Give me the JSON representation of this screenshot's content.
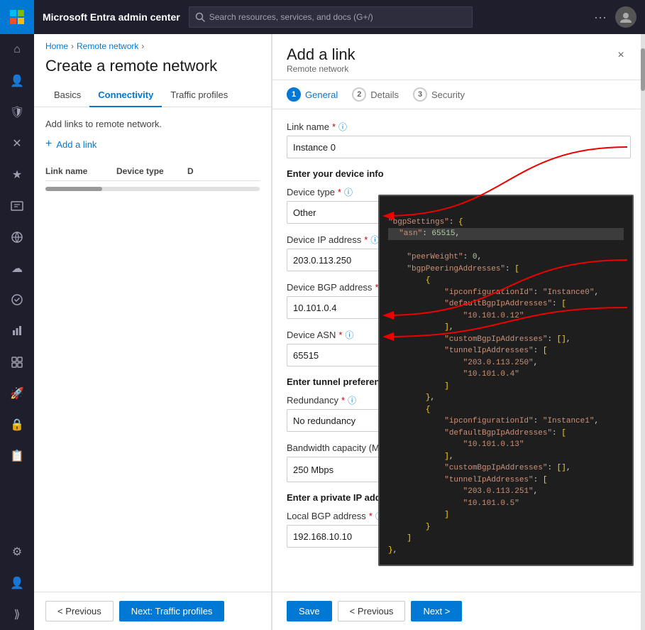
{
  "app": {
    "title": "Microsoft Entra admin center",
    "search_placeholder": "Search resources, services, and docs (G+/)"
  },
  "sidebar": {
    "icons": [
      {
        "name": "home-icon",
        "symbol": "⌂"
      },
      {
        "name": "users-icon",
        "symbol": "👤"
      },
      {
        "name": "shield-icon",
        "symbol": "🛡"
      },
      {
        "name": "cross-icon",
        "symbol": "✕"
      },
      {
        "name": "star-icon",
        "symbol": "★"
      },
      {
        "name": "id-icon",
        "symbol": "🪪"
      },
      {
        "name": "grid-icon",
        "symbol": "⊞"
      },
      {
        "name": "cloud-icon",
        "symbol": "☁"
      },
      {
        "name": "globe-icon",
        "symbol": "🌐"
      },
      {
        "name": "chart-icon",
        "symbol": "▦"
      },
      {
        "name": "puzzle-icon",
        "symbol": "🧩"
      },
      {
        "name": "rocket-icon",
        "symbol": "🚀"
      },
      {
        "name": "lock-icon",
        "symbol": "🔒"
      },
      {
        "name": "table-icon",
        "symbol": "📋"
      },
      {
        "name": "settings-icon",
        "symbol": "⚙"
      },
      {
        "name": "person-icon",
        "symbol": "👤"
      },
      {
        "name": "expand-icon",
        "symbol": "⟫"
      }
    ]
  },
  "breadcrumb": {
    "home": "Home",
    "remote_network": "Remote network",
    "separator": "›"
  },
  "page": {
    "title": "Create a remote network",
    "add_links_text": "Add links to remote network."
  },
  "tabs": [
    {
      "label": "Basics",
      "active": false
    },
    {
      "label": "Connectivity",
      "active": true
    },
    {
      "label": "Traffic profiles",
      "active": false
    }
  ],
  "table": {
    "col_link_name": "Link name",
    "col_device_type": "Device type",
    "col_d": "D"
  },
  "add_link_btn": "+ Add a link",
  "left_footer": {
    "prev_label": "< Previous",
    "next_label": "Next: Traffic profiles"
  },
  "drawer": {
    "title": "Add a link",
    "subtitle": "Remote network",
    "close": "×",
    "steps": [
      {
        "num": "1",
        "label": "General",
        "active": true
      },
      {
        "num": "2",
        "label": "Details",
        "active": false
      },
      {
        "num": "3",
        "label": "Security",
        "active": false
      }
    ],
    "form": {
      "link_name_label": "Link name",
      "link_name_required": "*",
      "link_name_value": "Instance 0",
      "device_info_heading": "Enter your device info",
      "device_type_label": "Device type",
      "device_type_required": "*",
      "device_type_value": "Other",
      "device_ip_label": "Device IP address",
      "device_ip_required": "*",
      "device_ip_value": "203.0.113.250",
      "device_bgp_label": "Device BGP address",
      "device_bgp_required": "*",
      "device_bgp_value": "10.101.0.4",
      "device_asn_label": "Device ASN",
      "device_asn_required": "*",
      "device_asn_value": "65515",
      "tunnel_heading": "Enter tunnel preference",
      "redundancy_label": "Redundancy",
      "redundancy_required": "*",
      "redundancy_value": "No redundancy",
      "bandwidth_label": "Bandwidth capacity (Mbps)",
      "bandwidth_required": "*",
      "bandwidth_value": "250 Mbps",
      "gateway_title": "Enter a private IP address you want to use for Microsoft gateway",
      "local_bgp_label": "Local BGP address",
      "local_bgp_required": "*",
      "local_bgp_value": "192.168.10.10"
    },
    "footer": {
      "save_label": "Save",
      "prev_label": "< Previous",
      "next_label": "Next >"
    }
  },
  "json_code": {
    "line1": "\"bgpSettings\": {",
    "line2": "    \"asn\": 65515,",
    "line3": "    \"peerWeight\": 0,",
    "line4": "    \"bgpPeeringAddresses\": [",
    "line5": "        {",
    "line6": "            \"ipconfigurationId\": \"Instance0\",",
    "line7": "            \"defaultBgpIpAddresses\": [",
    "line8": "                \"10.101.0.12\"",
    "line9": "            ],",
    "line10": "            \"customBgpIpAddresses\": [],",
    "line11": "            \"tunnelIpAddresses\": [",
    "line12": "                \"203.0.113.250\",",
    "line13": "                \"10.101.0.4\"",
    "line14": "            ]",
    "line15": "        },",
    "line16": "        {",
    "line17": "            \"ipconfigurationId\": \"Instance1\",",
    "line18": "            \"defaultBgpIpAddresses\": [",
    "line19": "                \"10.101.0.13\"",
    "line20": "            ],",
    "line21": "            \"customBgpIpAddresses\": [],",
    "line22": "            \"tunnelIpAddresses\": [",
    "line23": "                \"203.0.113.251\",",
    "line24": "                \"10.101.0.5\"",
    "line25": "            ]",
    "line26": "        }",
    "line27": "    ]",
    "line28": "},"
  }
}
